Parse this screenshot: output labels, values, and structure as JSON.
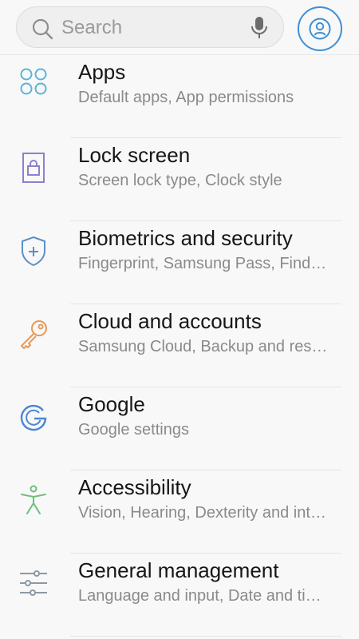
{
  "search": {
    "placeholder": "Search"
  },
  "items": [
    {
      "title": "Apps",
      "subtitle": "Default apps, App permissions",
      "icon": "apps-grid-icon",
      "color": "#5ab4d6"
    },
    {
      "title": "Lock screen",
      "subtitle": "Screen lock type, Clock style",
      "icon": "lock-screen-icon",
      "color": "#8c7fd0"
    },
    {
      "title": "Biometrics and security",
      "subtitle": "Fingerprint, Samsung Pass, Find…",
      "icon": "shield-icon",
      "color": "#5b8fc4"
    },
    {
      "title": "Cloud and accounts",
      "subtitle": "Samsung Cloud, Backup and res…",
      "icon": "key-icon",
      "color": "#e79a5a"
    },
    {
      "title": "Google",
      "subtitle": "Google settings",
      "icon": "google-icon",
      "color": "#4b86d8"
    },
    {
      "title": "Accessibility",
      "subtitle": "Vision, Hearing, Dexterity and int…",
      "icon": "accessibility-icon",
      "color": "#6fbf7a"
    },
    {
      "title": "General management",
      "subtitle": "Language and input, Date and ti…",
      "icon": "sliders-icon",
      "color": "#8e98a6"
    }
  ]
}
